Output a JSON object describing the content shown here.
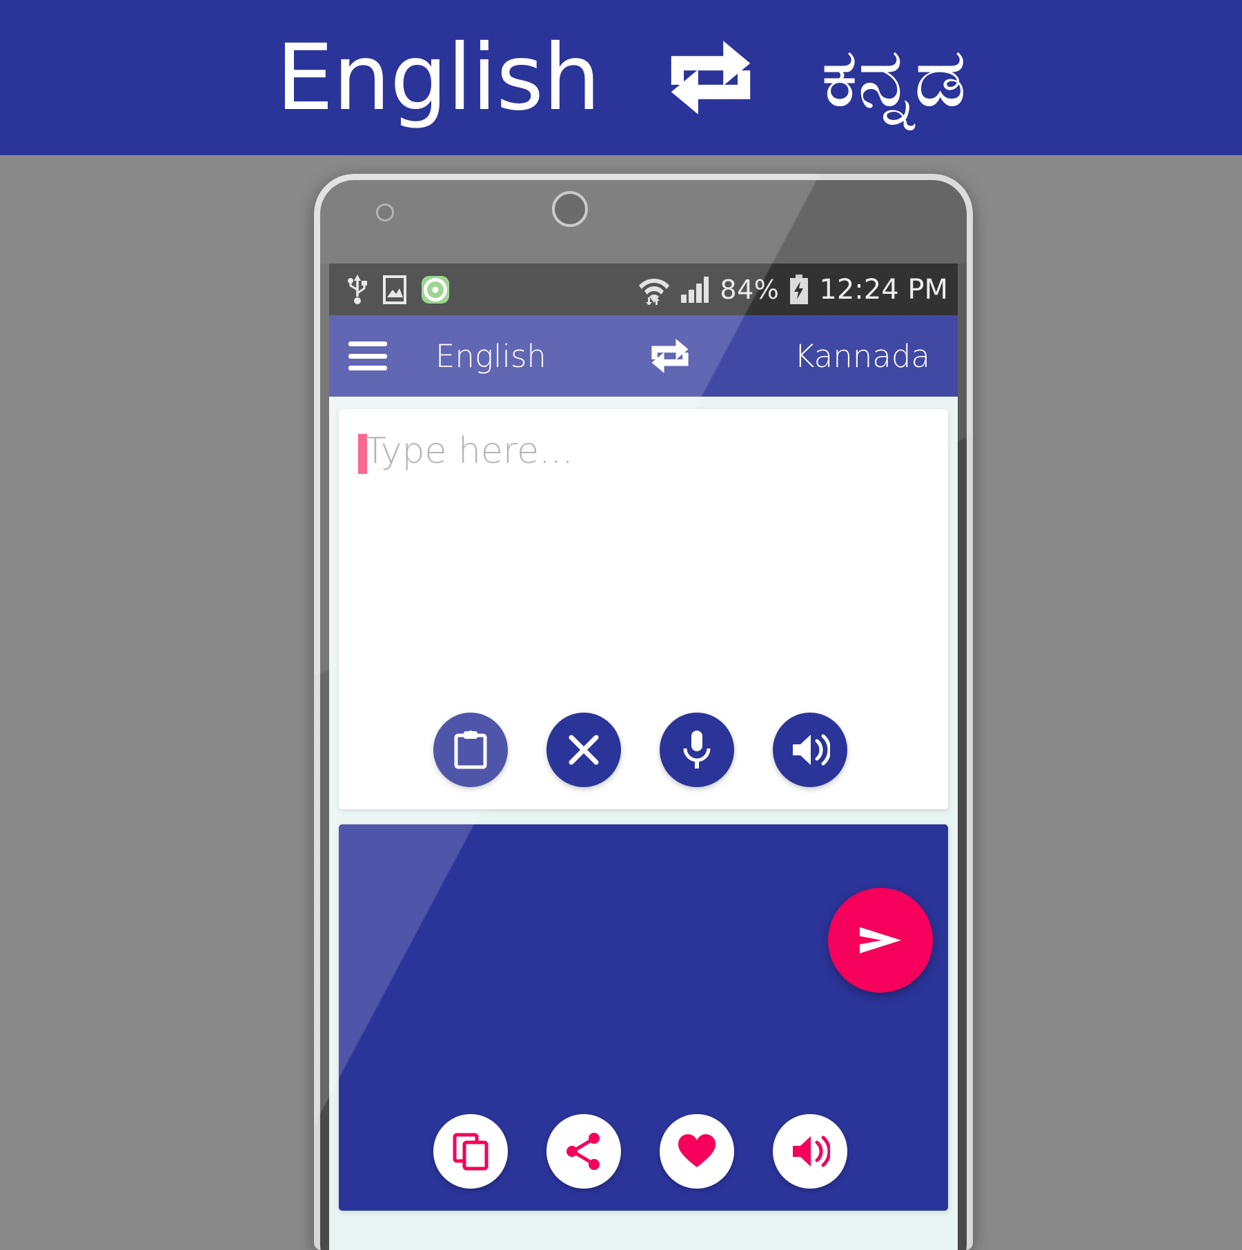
{
  "banner": {
    "source_language": "English",
    "swap_icon": "swap-horizontal-icon",
    "target_language": "ಕನ್ನಡ",
    "background_color": "#2b3499"
  },
  "phone": {
    "status_bar": {
      "left_icons": [
        "usb-icon",
        "screenshot-icon",
        "app-notification-icon"
      ],
      "wifi_icon": "wifi-data-icon",
      "signal_icon": "cellular-signal-icon",
      "battery_percent": "84%",
      "battery_icon": "battery-charging-icon",
      "time": "12:24 PM"
    },
    "toolbar": {
      "menu_icon": "hamburger-menu-icon",
      "source_language": "English",
      "swap_icon": "swap-horizontal-icon",
      "target_language": "Kannada",
      "background_color": "#2b3499"
    },
    "input_card": {
      "placeholder": "Type here...",
      "value": "",
      "caret_color": "#f5356e",
      "actions": [
        {
          "name": "paste-button",
          "icon": "clipboard-icon",
          "label": "Paste"
        },
        {
          "name": "clear-button",
          "icon": "close-icon",
          "label": "Clear"
        },
        {
          "name": "voice-input-button",
          "icon": "microphone-icon",
          "label": "Speak"
        },
        {
          "name": "speak-source-button",
          "icon": "speaker-icon",
          "label": "Listen"
        }
      ]
    },
    "send_button": {
      "icon": "send-icon",
      "label": "Translate",
      "color": "#f5005a"
    },
    "output_card": {
      "value": "",
      "background_color": "#2b3499",
      "actions": [
        {
          "name": "copy-button",
          "icon": "copy-icon",
          "label": "Copy"
        },
        {
          "name": "share-button",
          "icon": "share-icon",
          "label": "Share"
        },
        {
          "name": "favorite-button",
          "icon": "heart-icon",
          "label": "Favorite"
        },
        {
          "name": "speak-result-button",
          "icon": "speaker-icon",
          "label": "Listen"
        }
      ]
    }
  }
}
